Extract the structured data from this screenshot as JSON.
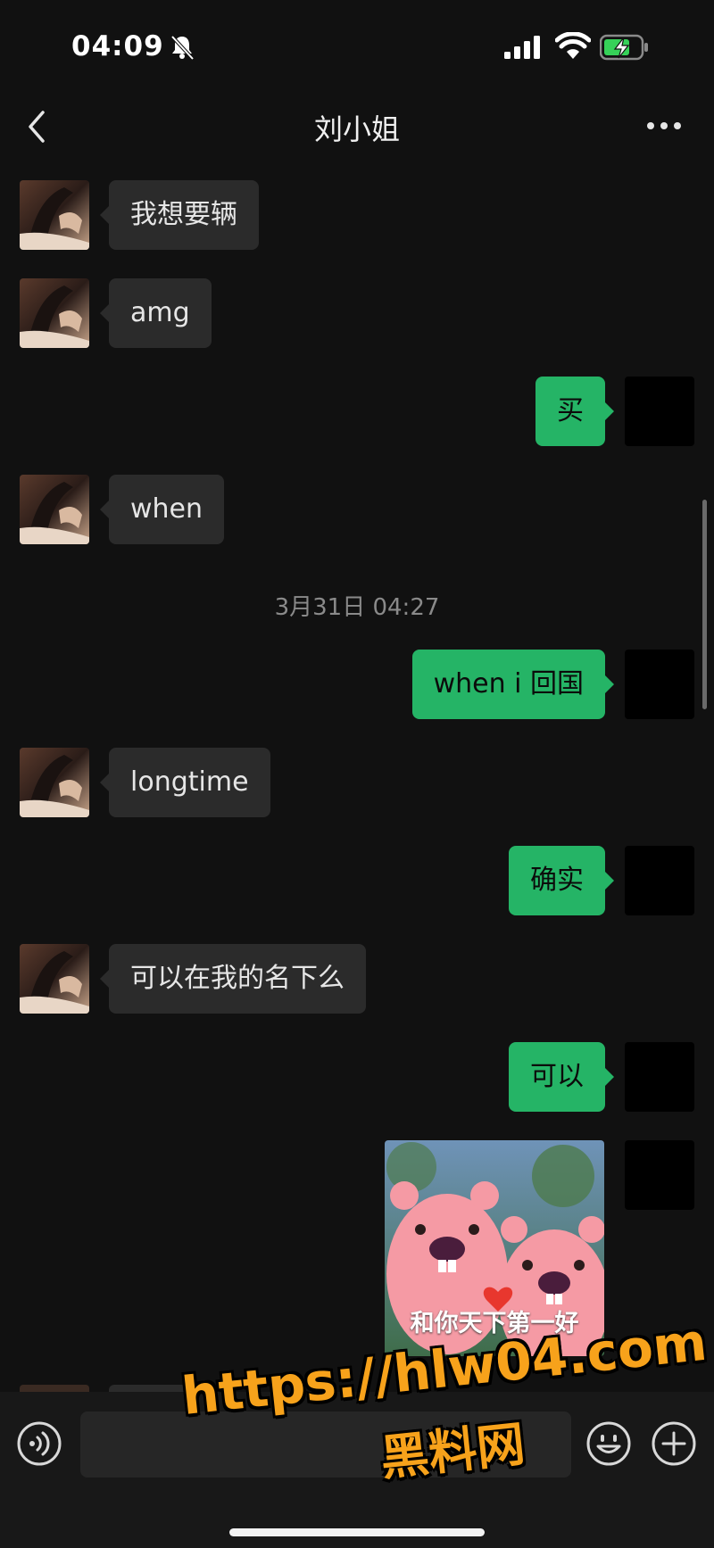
{
  "status_bar": {
    "time": "04:09",
    "icons": [
      "bell-slash-icon",
      "signal-icon",
      "wifi-icon",
      "battery-charging-icon"
    ]
  },
  "header": {
    "title": "刘小姐",
    "back_icon": "chevron-left-icon",
    "more_icon": "more-dots-icon"
  },
  "messages": [
    {
      "side": "incoming",
      "text": "我想要辆"
    },
    {
      "side": "incoming",
      "text": "amg"
    },
    {
      "side": "outgoing",
      "text": "买"
    },
    {
      "side": "incoming",
      "text": "when"
    },
    {
      "side": "timestamp",
      "text": "3月31日 04:27"
    },
    {
      "side": "outgoing",
      "text": "when i 回国"
    },
    {
      "side": "incoming",
      "text": "longtime"
    },
    {
      "side": "outgoing",
      "text": "确实"
    },
    {
      "side": "incoming",
      "text": "可以在我的名下么"
    },
    {
      "side": "outgoing",
      "text": "可以"
    },
    {
      "side": "outgoing",
      "type": "sticker",
      "caption": "和你天下第一好"
    }
  ],
  "input_bar": {
    "voice_icon": "voice-icon",
    "emoji_icon": "emoji-icon",
    "plus_icon": "plus-icon",
    "input_value": ""
  },
  "watermark": {
    "url": "https://hlw04.com",
    "name": "黑料网"
  },
  "colors": {
    "background": "#111111",
    "incoming_bubble": "#2b2b2b",
    "outgoing_bubble": "#25b466",
    "watermark": "#f7a21b"
  }
}
